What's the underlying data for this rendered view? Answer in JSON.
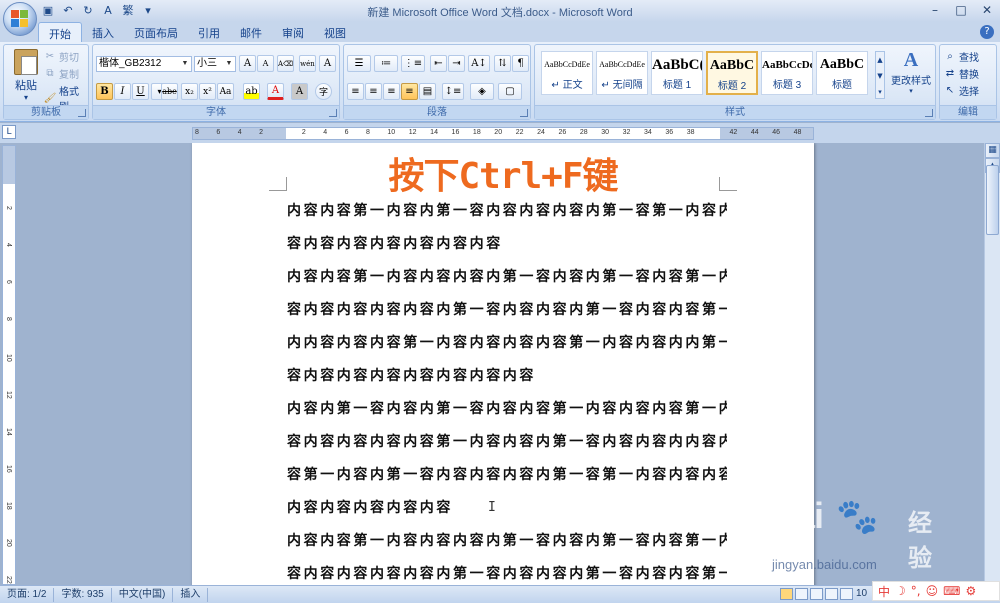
{
  "window": {
    "title": "新建 Microsoft Office Word 文档.docx - Microsoft Word",
    "minimize": "–",
    "maximize": "□",
    "close": "✕"
  },
  "qat": {
    "font_icon_glyph": "繁"
  },
  "tabs": [
    {
      "label": "开始",
      "active": true
    },
    {
      "label": "插入"
    },
    {
      "label": "页面布局"
    },
    {
      "label": "引用"
    },
    {
      "label": "邮件"
    },
    {
      "label": "审阅"
    },
    {
      "label": "视图"
    }
  ],
  "ribbon": {
    "clipboard": {
      "group_label": "剪贴板",
      "paste": "粘贴",
      "cut": "剪切",
      "copy": "复制",
      "format_painter": "格式刷"
    },
    "font": {
      "group_label": "字体",
      "font_name": "楷体_GB2312",
      "font_size": "小三",
      "grow": "A",
      "shrink": "A",
      "bold": "B",
      "italic": "I",
      "underline": "U",
      "strike": "abe",
      "subscript": "x₂",
      "superscript": "x²",
      "change_case": "Aa",
      "font_color": "A",
      "char_border": "A",
      "char_shading": "A",
      "phonetic": "wén",
      "clear_format": "字"
    },
    "paragraph": {
      "group_label": "段落"
    },
    "styles": {
      "group_label": "样式",
      "items": [
        {
          "sample": "AaBbCcDdEe",
          "name": "↵ 正文"
        },
        {
          "sample": "AaBbCcDdEe",
          "name": "↵ 无间隔"
        },
        {
          "sample": "AaBbC(",
          "name": "标题 1"
        },
        {
          "sample": "AaBbC",
          "name": "标题 2",
          "selected": true
        },
        {
          "sample": "AaBbCcDc",
          "name": "标题 3"
        },
        {
          "sample": "AaBbC",
          "name": "标题"
        }
      ],
      "change_styles": "更改样式"
    },
    "editing": {
      "group_label": "编辑",
      "find": "查找",
      "replace": "替换",
      "select": "选择"
    }
  },
  "ruler": {
    "h_ticks": [
      "8",
      "6",
      "4",
      "2",
      "",
      "2",
      "4",
      "6",
      "8",
      "10",
      "12",
      "14",
      "16",
      "18",
      "20",
      "22",
      "24",
      "26",
      "28",
      "30",
      "32",
      "34",
      "36",
      "38",
      "",
      "42",
      "44",
      "46",
      "48"
    ],
    "v_ticks": [
      "2",
      "4",
      "6",
      "8",
      "10",
      "12",
      "14",
      "16",
      "18",
      "20",
      "22"
    ]
  },
  "document": {
    "overlay_title": "按下Ctrl+F键",
    "lines": [
      "内容内容第一内容内第一容内容内容内容内第一容第一内容内",
      "容内容内容内容内容内容内容",
      "内容内容第一内容内容内容内第一容内容内第一容内容第一内",
      "容内容内容内容内容内第一容内容内容内第一容内容内容第一",
      "内内容内容内容第一内容内容内容内容第一内容内容内内第一",
      "容内容内容内容内容内容内容内容",
      "内容内第一容内容内第一容内容内容第一内容内容内容第一内",
      "容内容内容内容内容第一内容内容内第一容内容内容内内容内",
      "容第一内容内第一容内容内容内容内第一容第一内容内容内容",
      "内容内容内容内容内容",
      "内容内容第一内容内容内容内第一容内容内第一容内容第一内",
      "容内容内容内容内容内第一容内容内容内第一容内容内容第一"
    ]
  },
  "status": {
    "page": "页面: 1/2",
    "words": "字数: 935",
    "language": "中文(中国)",
    "insert": "插入",
    "zoom": "10"
  },
  "watermark": {
    "brand": "Bai",
    "brand2": "经验",
    "url": "jingyan.baidu.com"
  },
  "ime": {
    "mode": "中"
  },
  "colors": {
    "title_orange": "#ee6a1f",
    "ribbon_bg": "#d5e3f5",
    "doc_bg": "#9fb3cf"
  }
}
